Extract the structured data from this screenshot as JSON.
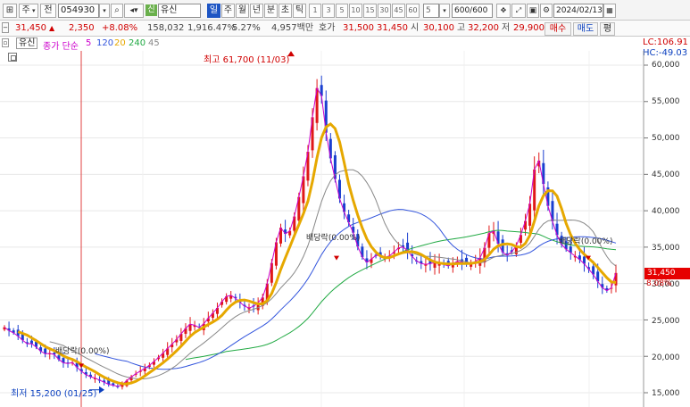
{
  "toolbar": {
    "market_btn": "주",
    "market_btn2": "전",
    "code": "054930",
    "name_badge": "신",
    "name": "유신",
    "periods": [
      "일",
      "주",
      "월",
      "년",
      "분",
      "초",
      "틱"
    ],
    "tick_nums": [
      "1",
      "3",
      "5",
      "10",
      "15",
      "30",
      "45",
      "60"
    ],
    "unit_value": "5",
    "count_value": "600/600",
    "date_value": "2024/02/13"
  },
  "quote": {
    "price": "31,450",
    "change": "2,350",
    "change_pct": "+8.08%",
    "volume": "158,032",
    "turnover_pct": "1,916.47%",
    "ratio_pct": "5.27%",
    "amount": "4,957백만",
    "ask_label": "호가",
    "ask_1": "31,500",
    "ask_2": "31,450",
    "open_label": "시",
    "open": "30,100",
    "high_label": "고",
    "high": "32,200",
    "low_label": "저",
    "low": "29,900",
    "buy_btn": "매수",
    "sell_btn": "매도",
    "eval_btn": "평"
  },
  "legend": {
    "name": "유신",
    "ma_title": "종가 단순",
    "ma_periods": [
      "5",
      "120",
      "20",
      "240",
      "45"
    ],
    "ma_colors": [
      "#cc00cc",
      "#3355dd",
      "#e6a800",
      "#22aa44",
      "#888888"
    ],
    "lc": "LC:106.91",
    "hc": "HC:-49.03"
  },
  "chart_data": {
    "type": "candlestick",
    "y_axis_ticks": [
      "60,000",
      "55,000",
      "50,000",
      "45,000",
      "40,000",
      "35,000",
      "30,000",
      "25,000",
      "20,000",
      "15,000"
    ],
    "ylim": [
      14000,
      63000
    ],
    "current_price_label": "31,450",
    "current_pct_label": "8.08%",
    "annotations": {
      "high": "최고 61,700 (11/03)",
      "low": "최저 15,200 (01/25)",
      "dividend_1": "배당락(0.00%)",
      "dividend_2": "배당락(0.00%)",
      "dividend_3": "배당락(0.00%)"
    },
    "close_path": [
      24000,
      23500,
      23200,
      22700,
      22100,
      21600,
      21800,
      21000,
      20500,
      20200,
      20600,
      19800,
      19200,
      18900,
      19300,
      18600,
      18000,
      17500,
      17200,
      17000,
      16700,
      16400,
      16100,
      16000,
      15800,
      16300,
      16900,
      17400,
      17800,
      18200,
      18600,
      19100,
      19700,
      20300,
      21000,
      21600,
      22300,
      23100,
      23900,
      24500,
      24200,
      23900,
      24700,
      25500,
      26200,
      27000,
      28000,
      28500,
      28200,
      27600,
      27000,
      26600,
      26800,
      27300,
      28000,
      30000,
      33000,
      36000,
      38000,
      36500,
      37500,
      40000,
      43000,
      46000,
      50000,
      56000,
      58000,
      52000,
      48000,
      45000,
      42000,
      40000,
      38500,
      37000,
      35000,
      33500,
      32800,
      33500,
      34000,
      33800,
      33500,
      34000,
      34600,
      35200,
      34800,
      34000,
      33200,
      32800,
      32600,
      32700,
      32900,
      32800,
      32600,
      32400,
      32800,
      33100,
      32900,
      32600,
      32800,
      33200,
      33800,
      36000,
      38000,
      36000,
      34500,
      33800,
      34200,
      35000,
      36500,
      38500,
      41000,
      46000,
      47000,
      43000,
      40000,
      38000,
      36000,
      35000,
      34500,
      34000,
      33500,
      33000,
      32200,
      31500,
      30500,
      29500,
      29000,
      29300,
      31450
    ]
  }
}
